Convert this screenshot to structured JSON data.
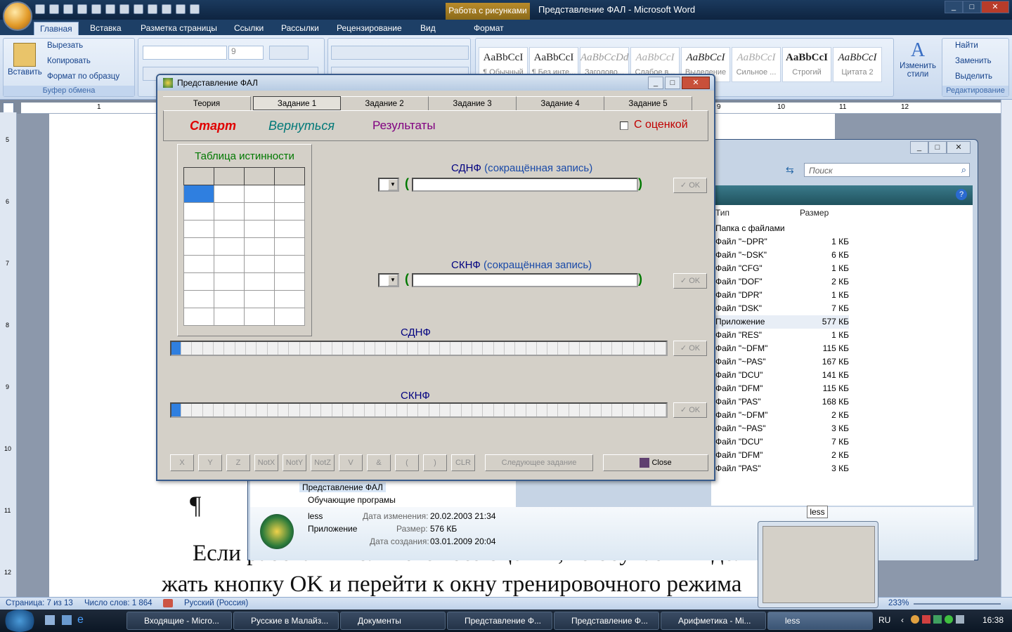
{
  "word": {
    "context_tab": "Работа с рисунками",
    "title": "Представление ФАЛ - Microsoft Word",
    "ribbon_tabs": [
      "Главная",
      "Вставка",
      "Разметка страницы",
      "Ссылки",
      "Рассылки",
      "Рецензирование",
      "Вид",
      "Формат"
    ],
    "clipboard": {
      "paste": "Вставить",
      "cut": "Вырезать",
      "copy": "Копировать",
      "format_painter": "Формат по образцу",
      "group": "Буфер обмена"
    },
    "font_size": "9",
    "styles": [
      {
        "sample": "AaBbCcI",
        "name": "¶ Обычный"
      },
      {
        "sample": "AaBbCcI",
        "name": "¶ Без инте..."
      },
      {
        "sample": "AaBbCcDd",
        "name": "Заголово..."
      },
      {
        "sample": "AaBbCcI",
        "name": "Слабое в..."
      },
      {
        "sample": "AaBbCcI",
        "name": "Выделение"
      },
      {
        "sample": "AaBbCcI",
        "name": "Сильное ..."
      },
      {
        "sample": "AaBbCcI",
        "name": "Строгий"
      },
      {
        "sample": "AaBbCcI",
        "name": "Цитата 2"
      }
    ],
    "change_styles": "Изменить стили",
    "editing": {
      "find": "Найти",
      "replace": "Заменить",
      "select": "Выделить",
      "group": "Редактирование"
    },
    "doc_lines": [
      "Если работа выполняется без оценки, то обучаемый должен",
      "жать кнопку OK и перейти к окну тренировочного режима"
    ],
    "pilcrow": "¶",
    "ruler_h": [
      "1",
      "9",
      "10",
      "11",
      "12"
    ],
    "ruler_v": [
      "5",
      "6",
      "7",
      "8",
      "9",
      "10",
      "11",
      "12"
    ],
    "status": {
      "page": "Страница: 7 из 13",
      "words": "Число слов: 1 864",
      "lang": "Русский (Россия)",
      "zoom": "233%"
    }
  },
  "explorer": {
    "search_placeholder": "Поиск",
    "col_type": "Тип",
    "col_size": "Размер",
    "rows": [
      {
        "type": "Папка с файлами",
        "size": ""
      },
      {
        "type": "Файл \"~DPR\"",
        "size": "1 КБ"
      },
      {
        "type": "Файл \"~DSK\"",
        "size": "6 КБ"
      },
      {
        "type": "Файл \"CFG\"",
        "size": "1 КБ"
      },
      {
        "type": "Файл \"DOF\"",
        "size": "2 КБ"
      },
      {
        "type": "Файл \"DPR\"",
        "size": "1 КБ"
      },
      {
        "type": "Файл \"DSK\"",
        "size": "7 КБ"
      },
      {
        "type": "Приложение",
        "size": "577 КБ"
      },
      {
        "type": "Файл \"RES\"",
        "size": "1 КБ"
      },
      {
        "type": "Файл \"~DFM\"",
        "size": "115 КБ"
      },
      {
        "type": "Файл \"~PAS\"",
        "size": "167 КБ"
      },
      {
        "type": "Файл \"DCU\"",
        "size": "141 КБ"
      },
      {
        "type": "Файл \"DFM\"",
        "size": "115 КБ"
      },
      {
        "type": "Файл \"PAS\"",
        "size": "168 КБ"
      },
      {
        "type": "Файл \"~DFM\"",
        "size": "2 КБ"
      },
      {
        "type": "Файл \"~PAS\"",
        "size": "3 КБ"
      },
      {
        "type": "Файл \"DCU\"",
        "size": "7 КБ"
      },
      {
        "type": "Файл \"DFM\"",
        "size": "2 КБ"
      },
      {
        "type": "Файл \"PAS\"",
        "size": "3 КБ"
      }
    ],
    "tree": [
      "Представление ФАЛ",
      "Обучающие програмы"
    ],
    "details": {
      "name": "less",
      "kind": "Приложение",
      "modified_label": "Дата изменения:",
      "modified": "20.02.2003 21:34",
      "size_label": "Размер:",
      "size": "576 КБ",
      "created_label": "Дата создания:",
      "created": "03.01.2009 20:04"
    }
  },
  "fal": {
    "title": "Представление ФАЛ",
    "tabs": [
      "Теория",
      "Задание 1",
      "Задание 2",
      "Задание 3",
      "Задание 4",
      "Задание 5"
    ],
    "start": "Старт",
    "back": "Вернуться",
    "results": "Результаты",
    "with_grade": "С оценкой",
    "truth_table": "Таблица истинности",
    "sdnf_short": "СДНФ",
    "sknf_short": "СКНФ",
    "short_note": "(сокращённая запись)",
    "sdnf": "СДНФ",
    "sknf": "СКНФ",
    "ok": "OK",
    "paren_open": "(",
    "paren_close": ")",
    "keys": [
      "X",
      "Y",
      "Z",
      "NotX",
      "NotY",
      "NotZ",
      "V",
      "&",
      "(",
      ")",
      "CLR"
    ],
    "next_task": "Следующее задание",
    "close": "Close"
  },
  "taskbar": {
    "items": [
      "Входящие - Micro...",
      "Русские в Малайз...",
      "Документы",
      "Представление Ф...",
      "Представление Ф...",
      "Арифметика - Mi...",
      "less"
    ],
    "lang": "RU",
    "time": "16:38",
    "tooltip": "less"
  },
  "colors": {
    "start": "#e00000",
    "back": "#007878",
    "results": "#800080",
    "grade": "#c00000",
    "titleblue": "#000080"
  }
}
